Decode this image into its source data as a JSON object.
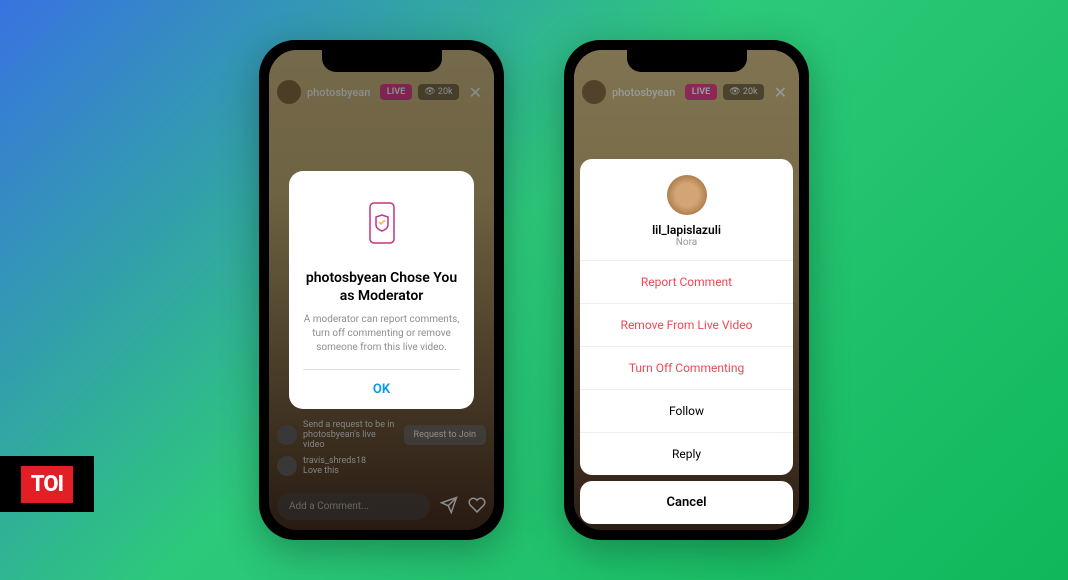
{
  "badge": {
    "toi": "TOI"
  },
  "live": {
    "username": "photosbyean",
    "live_label": "LIVE",
    "viewers": "20k"
  },
  "modal": {
    "title": "photosbyean Chose You as Moderator",
    "description": "A moderator can report comments, turn off commenting or remove someone from this live video.",
    "ok": "OK"
  },
  "comments": {
    "request_text": "Send a request to be in photosbyean's live video",
    "request_button": "Request to Join",
    "user2": "travis_shreds18",
    "user2_comment": "Love this"
  },
  "input": {
    "placeholder": "Add a Comment..."
  },
  "sheet": {
    "username": "lil_lapislazuli",
    "name": "Nora",
    "report": "Report Comment",
    "remove": "Remove From Live Video",
    "turnoff": "Turn Off Commenting",
    "follow": "Follow",
    "reply": "Reply",
    "cancel": "Cancel"
  }
}
